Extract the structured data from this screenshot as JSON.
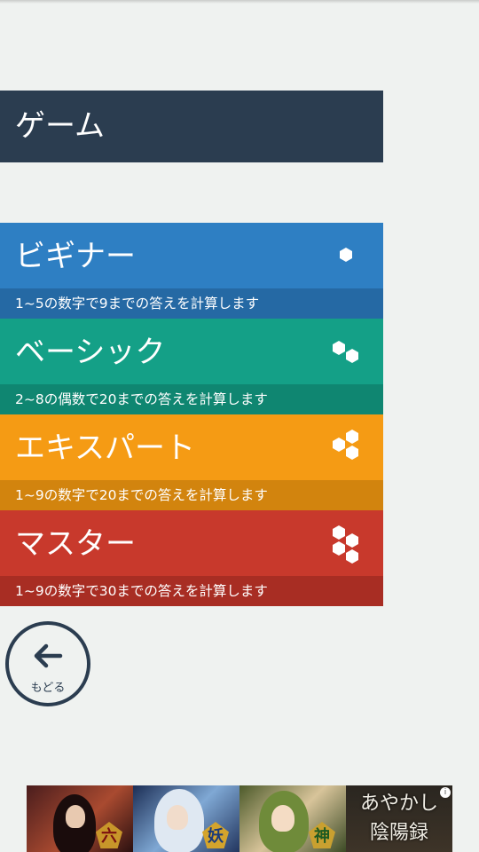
{
  "header": {
    "title": "ゲーム"
  },
  "levels": [
    {
      "title": "ビギナー",
      "description": "1~5の数字で9までの答えを計算します",
      "icon": "hexagon-1-icon",
      "color": "#2e7fc3"
    },
    {
      "title": "ベーシック",
      "description": "2~8の偶数で20までの答えを計算します",
      "icon": "hexagon-2-icon",
      "color": "#14a087"
    },
    {
      "title": "エキスパート",
      "description": "1~9の数字で20までの答えを計算します",
      "icon": "hexagon-3-icon",
      "color": "#f59b14"
    },
    {
      "title": "マスター",
      "description": "1~9の数字で30までの答えを計算します",
      "icon": "hexagon-4-icon",
      "color": "#c8392c"
    }
  ],
  "back_button": {
    "label": "もどる",
    "icon": "arrow-left-icon"
  },
  "ad": {
    "title_line1": "あやかし",
    "title_line2": "陰陽録",
    "badges": [
      "六",
      "妖",
      "神"
    ],
    "icon": "info-icon"
  }
}
